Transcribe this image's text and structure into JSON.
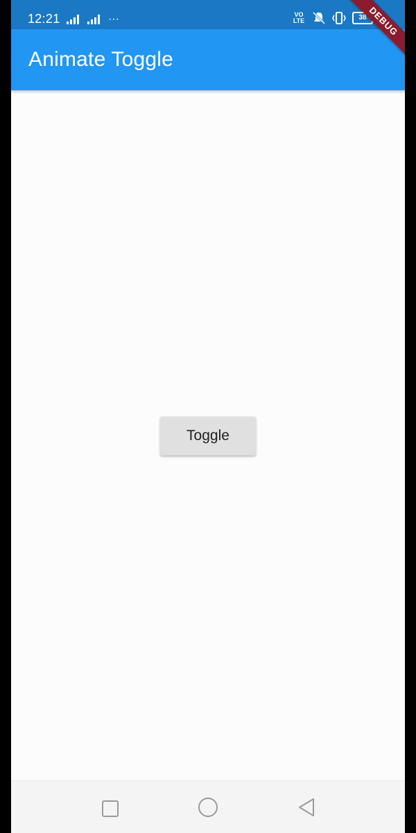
{
  "status_bar": {
    "time": "12:21",
    "more": "···",
    "volte": "VO\nLTE",
    "battery": "38",
    "icons": [
      "signal-icon",
      "signal-icon",
      "more-icon",
      "volte-icon",
      "muted-icon",
      "vibrate-icon",
      "battery-icon",
      "charging-icon"
    ]
  },
  "app_bar": {
    "title": "Animate Toggle",
    "color": "#2196f3"
  },
  "debug_banner": "DEBUG",
  "main": {
    "toggle_label": "Toggle"
  },
  "nav_bar": {
    "icons": [
      "recents-square-icon",
      "home-circle-icon",
      "back-triangle-icon"
    ]
  }
}
